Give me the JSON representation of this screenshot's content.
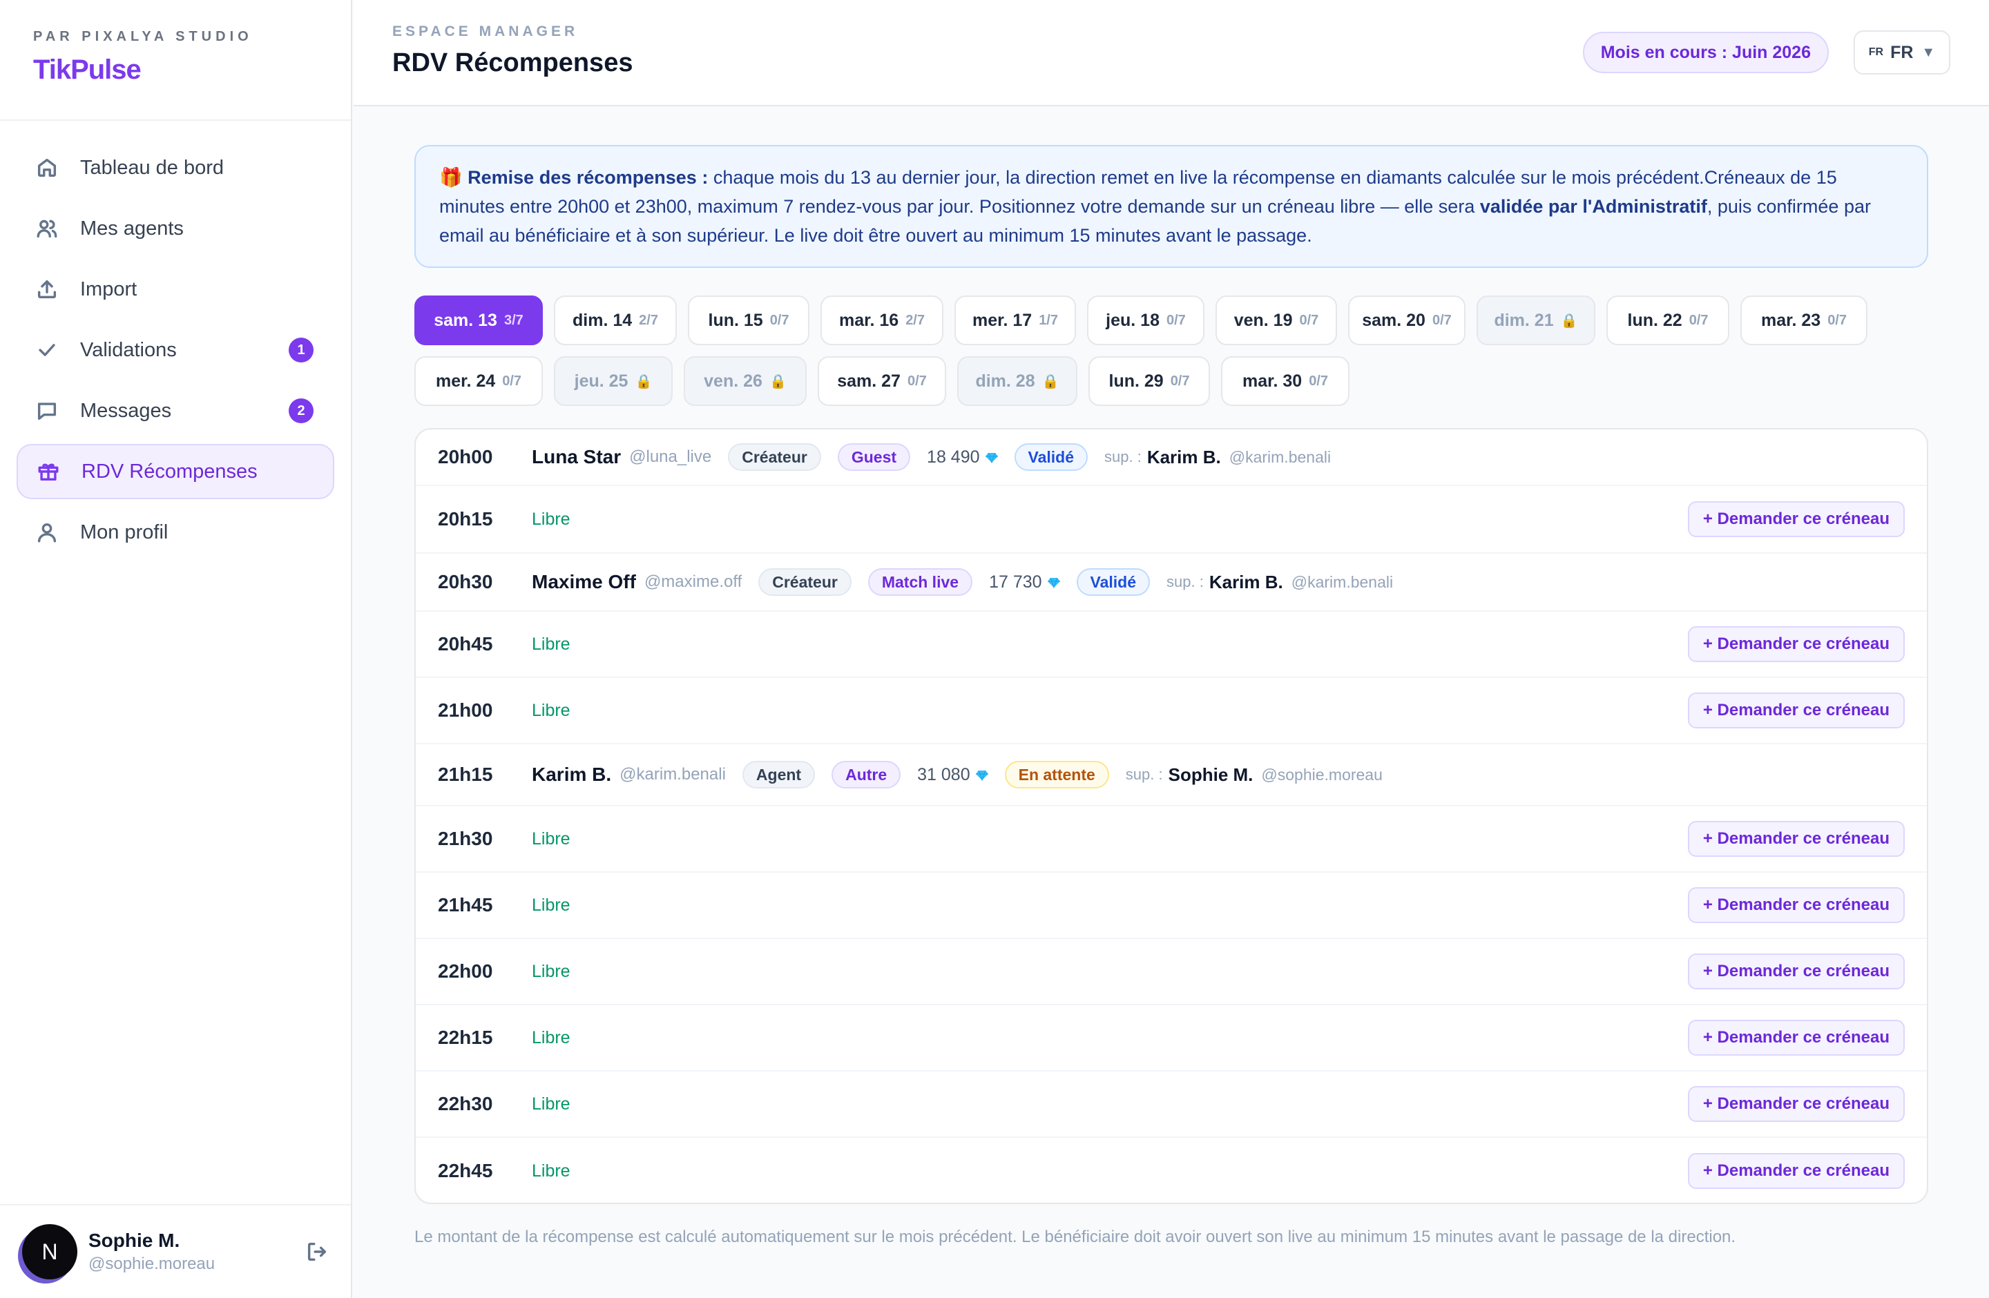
{
  "brand": {
    "studio": "PAR PIXALYA STUDIO",
    "name": "TikPulse"
  },
  "nav": [
    {
      "label": "Tableau de bord",
      "icon": "home-icon"
    },
    {
      "label": "Mes agents",
      "icon": "users-icon"
    },
    {
      "label": "Import",
      "icon": "upload-icon"
    },
    {
      "label": "Validations",
      "icon": "check-icon",
      "badge": "1"
    },
    {
      "label": "Messages",
      "icon": "message-icon",
      "badge": "2"
    },
    {
      "label": "RDV Récompenses",
      "icon": "gift-icon",
      "active": true
    },
    {
      "label": "Mon profil",
      "icon": "user-icon"
    }
  ],
  "user": {
    "initial": "N",
    "name": "Sophie M.",
    "handle": "@sophie.moreau"
  },
  "header": {
    "eyebrow": "ESPACE MANAGER",
    "title": "RDV Récompenses",
    "month": "Mois en cours : Juin 2026",
    "lang_flag": "FR",
    "lang": "FR",
    "caret": "▼"
  },
  "info": {
    "icon": "🎁",
    "lead": "Remise des récompenses :",
    "text1": " chaque mois du 13 au dernier jour, la direction remet en live la récompense en diamants calculée sur le mois précédent.Créneaux de 15 minutes entre 20h00 et 23h00, maximum 7 rendez-vous par jour. Positionnez votre demande sur un créneau libre — elle sera ",
    "strong": "validée par l'Administratif",
    "text2": ", puis confirmée par email au bénéficiaire et à son supérieur. Le live doit être ouvert au minimum 15 minutes avant le passage."
  },
  "days": [
    {
      "label": "sam. 13",
      "count": "3/7",
      "state": "selected"
    },
    {
      "label": "dim. 14",
      "count": "2/7",
      "state": "open"
    },
    {
      "label": "lun. 15",
      "count": "0/7",
      "state": "open"
    },
    {
      "label": "mar. 16",
      "count": "2/7",
      "state": "open"
    },
    {
      "label": "mer. 17",
      "count": "1/7",
      "state": "open"
    },
    {
      "label": "jeu. 18",
      "count": "0/7",
      "state": "open"
    },
    {
      "label": "ven. 19",
      "count": "0/7",
      "state": "open"
    },
    {
      "label": "sam. 20",
      "count": "0/7",
      "state": "open"
    },
    {
      "label": "dim. 21",
      "count": "🔒",
      "state": "locked"
    },
    {
      "label": "lun. 22",
      "count": "0/7",
      "state": "open"
    },
    {
      "label": "mar. 23",
      "count": "0/7",
      "state": "open"
    },
    {
      "label": "mer. 24",
      "count": "0/7",
      "state": "open"
    },
    {
      "label": "jeu. 25",
      "count": "🔒",
      "state": "locked"
    },
    {
      "label": "ven. 26",
      "count": "🔒",
      "state": "locked"
    },
    {
      "label": "sam. 27",
      "count": "0/7",
      "state": "open"
    },
    {
      "label": "dim. 28",
      "count": "🔒",
      "state": "locked"
    },
    {
      "label": "lun. 29",
      "count": "0/7",
      "state": "open"
    },
    {
      "label": "mar. 30",
      "count": "0/7",
      "state": "open"
    }
  ],
  "slots": [
    {
      "time": "20h00",
      "booked": true,
      "name": "Luna Star",
      "handle": "@luna_live",
      "role": "Créateur",
      "type": "Guest",
      "diamonds": "18 490",
      "status": "Validé",
      "status_kind": "ok",
      "sup_label": "sup. :",
      "sup_name": "Karim B.",
      "sup_handle": "@karim.benali"
    },
    {
      "time": "20h15",
      "booked": false,
      "libre": "Libre",
      "action": "+ Demander ce créneau"
    },
    {
      "time": "20h30",
      "booked": true,
      "name": "Maxime Off",
      "handle": "@maxime.off",
      "role": "Créateur",
      "type": "Match live",
      "diamonds": "17 730",
      "status": "Validé",
      "status_kind": "ok",
      "sup_label": "sup. :",
      "sup_name": "Karim B.",
      "sup_handle": "@karim.benali"
    },
    {
      "time": "20h45",
      "booked": false,
      "libre": "Libre",
      "action": "+ Demander ce créneau"
    },
    {
      "time": "21h00",
      "booked": false,
      "libre": "Libre",
      "action": "+ Demander ce créneau"
    },
    {
      "time": "21h15",
      "booked": true,
      "name": "Karim B.",
      "handle": "@karim.benali",
      "role": "Agent",
      "type": "Autre",
      "diamonds": "31 080",
      "status": "En attente",
      "status_kind": "wait",
      "sup_label": "sup. :",
      "sup_name": "Sophie M.",
      "sup_handle": "@sophie.moreau"
    },
    {
      "time": "21h30",
      "booked": false,
      "libre": "Libre",
      "action": "+ Demander ce créneau"
    },
    {
      "time": "21h45",
      "booked": false,
      "libre": "Libre",
      "action": "+ Demander ce créneau"
    },
    {
      "time": "22h00",
      "booked": false,
      "libre": "Libre",
      "action": "+ Demander ce créneau"
    },
    {
      "time": "22h15",
      "booked": false,
      "libre": "Libre",
      "action": "+ Demander ce créneau"
    },
    {
      "time": "22h30",
      "booked": false,
      "libre": "Libre",
      "action": "+ Demander ce créneau"
    },
    {
      "time": "22h45",
      "booked": false,
      "libre": "Libre",
      "action": "+ Demander ce créneau"
    }
  ],
  "footnote": "Le montant de la récompense est calculé automatiquement sur le mois précédent. Le bénéficiaire doit avoir ouvert son live au minimum 15 minutes avant le passage de la direction."
}
